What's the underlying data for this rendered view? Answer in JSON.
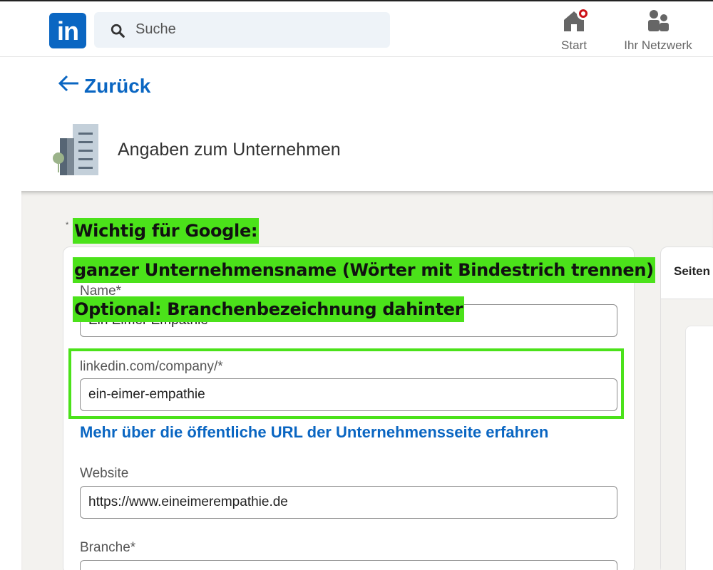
{
  "topbar": {
    "logo_text": "in",
    "search_placeholder": "Suche",
    "nav": {
      "start_label": "Start",
      "network_label": "Ihr Netzwerk"
    }
  },
  "back_label": "Zurück",
  "header": {
    "title": "Angaben zum Unternehmen"
  },
  "preview": {
    "label": "Seiten"
  },
  "form": {
    "name_label": "Name*",
    "name_value": "Ein Eimer Empathie",
    "url_label": "linkedin.com/company/*",
    "url_value": "ein-eimer-empathie",
    "learn_more_link": "Mehr über die öffentliche URL der Unternehmensseite erfahren",
    "website_label": "Website",
    "website_value": "https://www.eineimerempathie.de",
    "industry_label": "Branche*",
    "industry_value": ""
  },
  "annotations": {
    "line1": "Wichtig für Google:",
    "line2": "ganzer Unternehmensname (Wörter mit Bindestrich trennen)",
    "line3": "Optional: Branchenbezeichnung dahinter"
  },
  "colors": {
    "brand": "#0a66c2",
    "highlight": "#4be21a",
    "notification": "#cc1016",
    "page_bg": "#f3f2ef"
  }
}
